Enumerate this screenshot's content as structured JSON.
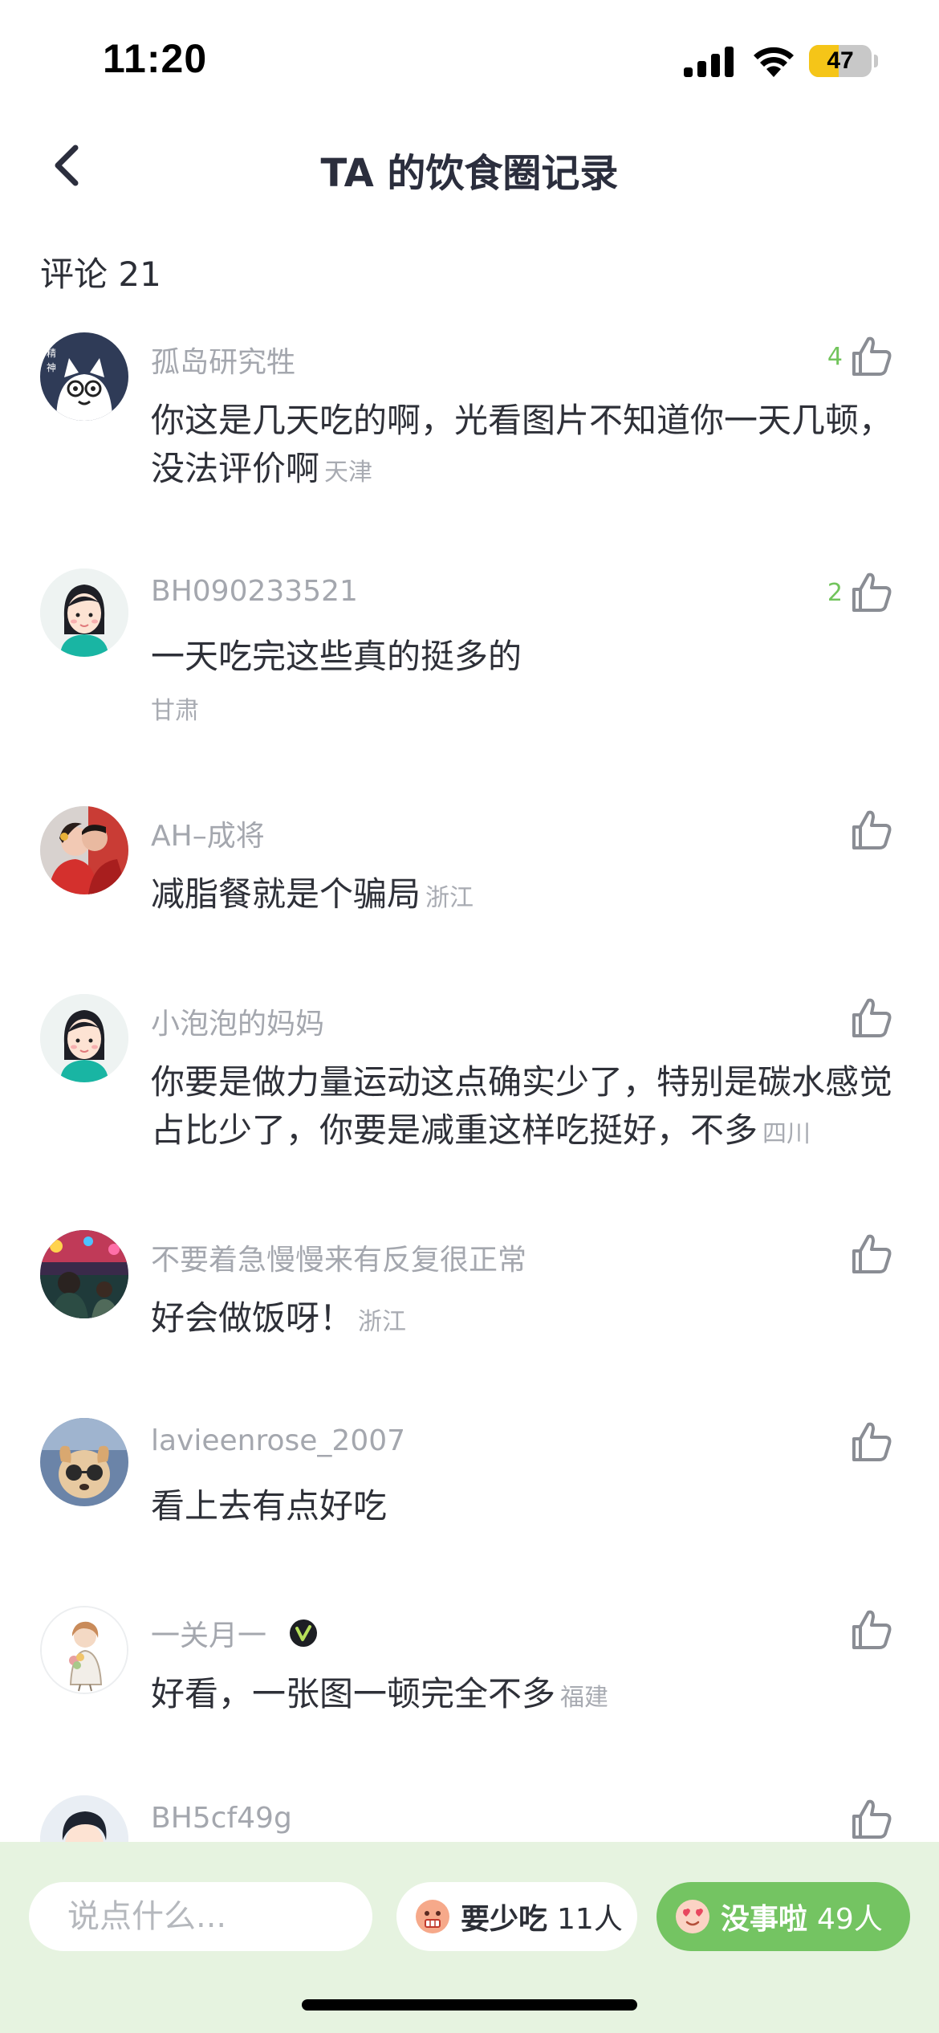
{
  "status_bar": {
    "time": "11:20",
    "battery": "47",
    "battery_level": 0.47
  },
  "nav": {
    "title": "TA 的饮食圈记录"
  },
  "comments_header": "评论 21",
  "comments": [
    {
      "user": "孤岛研究牲",
      "text": "你这是几天吃的啊，光看图片不知道你一天几顿，没法评价啊",
      "location": "天津",
      "likes": "4",
      "avatar": "cartoon-cat-avatar"
    },
    {
      "user": "BH090233521",
      "text": "一天吃完这些真的挺多的",
      "location": "甘肃",
      "likes": "2",
      "avatar": "cartoon-girl-avatar"
    },
    {
      "user": "AH–成将",
      "text": "减脂餐就是个骗局",
      "location": "浙江",
      "likes": "",
      "avatar": "wedding-photo-avatar"
    },
    {
      "user": "小泡泡的妈妈",
      "text": "你要是做力量运动这点确实少了，特别是碳水感觉占比少了，你要是减重这样吃挺好，不多",
      "location": "四川",
      "likes": "",
      "avatar": "cartoon-girl-avatar"
    },
    {
      "user": "不要着急慢慢来有反复很正常",
      "text": "好会做饭呀！",
      "location": "浙江",
      "likes": "",
      "avatar": "concert-photo-avatar"
    },
    {
      "user": "lavieenrose_2007",
      "text": "看上去有点好吃",
      "location": "",
      "likes": "",
      "avatar": "dog-photo-avatar"
    },
    {
      "user": "一关月一",
      "text": "好看，一张图一顿完全不多",
      "location": "福建",
      "likes": "",
      "avatar": "illustration-avatar",
      "verified": true
    },
    {
      "user": "BH5cf49g",
      "text": "",
      "location": "",
      "likes": "",
      "avatar": "cartoon-boy-avatar"
    }
  ],
  "bottom_bar": {
    "input_placeholder": "说点什么...",
    "vote_less": {
      "label": "要少吃",
      "count": "11人"
    },
    "vote_fine": {
      "label": "没事啦",
      "count": "49人"
    }
  },
  "colors": {
    "accent_green": "#74c462",
    "bottom_bg": "#e6f3e0",
    "like_count": "#72c45c"
  }
}
